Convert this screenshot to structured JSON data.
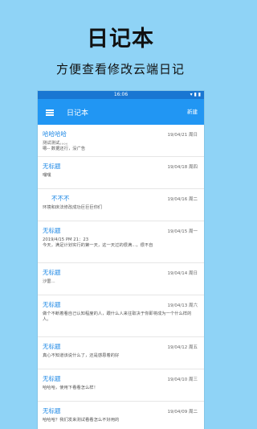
{
  "promo": {
    "title": "日记本",
    "subtitle": "方便查看修改云端日记"
  },
  "statusbar": {
    "time": "16:06",
    "right": "▾ ▮ ▮"
  },
  "appbar": {
    "title": "日记本",
    "new_label": "新建"
  },
  "entries": [
    {
      "title": "哈哈哈哈",
      "date": "19/04/21  周日",
      "body": "测试测试。。。。\n嗯--  数据还行，没广告"
    },
    {
      "title": "无标题",
      "date": "19/04/18  周四",
      "body": "嘿嘿"
    },
    {
      "title": "不不不",
      "date": "19/04/16  周二",
      "body": "环境和床法修改成功巨巨巨你们"
    },
    {
      "title": "无标题",
      "date": "19/04/15  周一",
      "body": "2019/4/15 PM 21：23\n今天，满足计划实行的第一天，这一天过的很满...，很不自"
    },
    {
      "title": "无标题",
      "date": "19/04/14  周日",
      "body": "沙雷..."
    },
    {
      "title": "无标题",
      "date": "19/04/13  周六",
      "body": "做个不断着看自己认知程度的人，跟什么人来往取决于你即将成为一个什么样的人。"
    },
    {
      "title": "无标题",
      "date": "19/04/12  周五",
      "body": "真心不知道该说什么了，还是感恩着的好"
    },
    {
      "title": "无标题",
      "date": "19/04/10  周三",
      "body": "哈哈哈，使用下看看怎么样！"
    },
    {
      "title": "无标题",
      "date": "19/04/09  周二",
      "body": "哈哈哈？我们发来测试看看怎么不好用的"
    }
  ]
}
